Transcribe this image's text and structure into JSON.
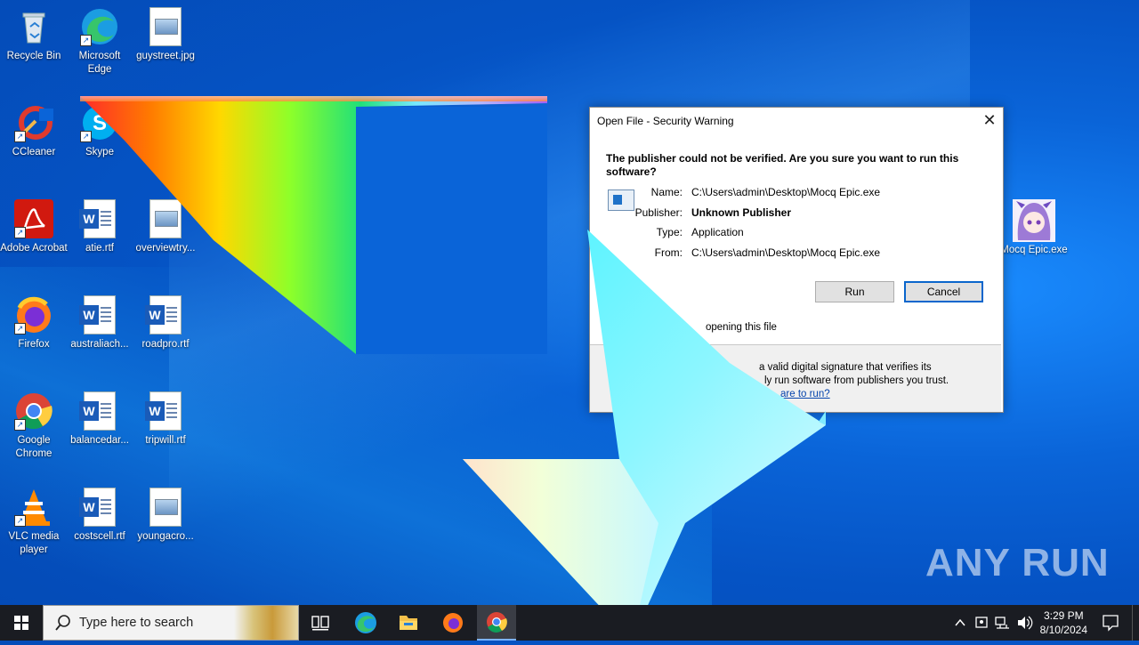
{
  "desktop": {
    "icons": [
      {
        "label": "Recycle Bin"
      },
      {
        "label": "Microsoft Edge"
      },
      {
        "label": "guystreet.jpg"
      },
      {
        "label": "CCleaner"
      },
      {
        "label": "Skype"
      },
      {
        "label": "Adobe Acrobat"
      },
      {
        "label": "atie.rtf"
      },
      {
        "label": "overviewtry..."
      },
      {
        "label": "Firefox"
      },
      {
        "label": "australiach..."
      },
      {
        "label": "roadpro.rtf"
      },
      {
        "label": "Google Chrome"
      },
      {
        "label": "balancedar..."
      },
      {
        "label": "tripwill.rtf"
      },
      {
        "label": "VLC media player"
      },
      {
        "label": "costscell.rtf"
      },
      {
        "label": "youngacro..."
      },
      {
        "label": "Mocq Epic.exe"
      }
    ]
  },
  "dialog": {
    "title": "Open File - Security Warning",
    "question": "The publisher could not be verified.  Are you sure you want to run this software?",
    "fields": [
      {
        "key": "Name:",
        "value": "C:\\Users\\admin\\Desktop\\Mocq Epic.exe"
      },
      {
        "key": "Publisher:",
        "value": "Unknown Publisher"
      },
      {
        "key": "Type:",
        "value": "Application"
      },
      {
        "key": "From:",
        "value": "C:\\Users\\admin\\Desktop\\Mocq Epic.exe"
      }
    ],
    "run_label": "Run",
    "cancel_label": "Cancel",
    "checkbox_text": "opening this file",
    "info_line1": "a valid digital signature that verifies its",
    "info_line2": "ly run software from publishers you trust.",
    "info_link": "are to run?"
  },
  "taskbar": {
    "search_placeholder": "Type here to search",
    "time": "3:29 PM",
    "date": "8/10/2024"
  },
  "watermark": "ANY RUN",
  "colors": {
    "accent": "#0a66cc",
    "taskbar": "#1a1c22"
  }
}
